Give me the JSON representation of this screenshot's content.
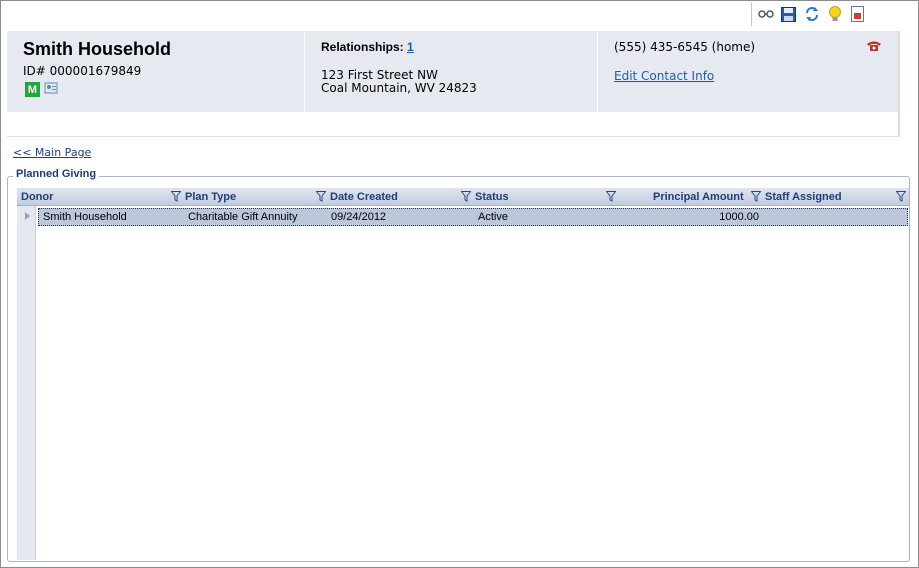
{
  "toolbar": {
    "icons": [
      "glasses-icon",
      "save-icon",
      "refresh-icon",
      "lightbulb-icon",
      "report-icon"
    ]
  },
  "header": {
    "name": "Smith Household",
    "id_line": "ID# 000001679849",
    "member_badge": "M",
    "relationships_label": "Relationships:",
    "relationships_count": "1",
    "address_line1": "123 First Street NW",
    "address_line2": "Coal Mountain, WV 24823",
    "phone": "(555) 435-6545 (home)",
    "edit_contact": "Edit Contact Info"
  },
  "nav": {
    "main_page_link": "<< Main Page"
  },
  "planned_giving": {
    "legend": "Planned Giving",
    "columns": [
      "Donor",
      "Plan Type",
      "Date Created",
      "Status",
      "Principal Amount",
      "Staff Assigned"
    ],
    "rows": [
      {
        "donor": "Smith Household",
        "plan_type": "Charitable Gift Annuity",
        "date_created": "09/24/2012",
        "status": "Active",
        "principal_amount": "1000.00",
        "staff_assigned": ""
      }
    ]
  },
  "colors": {
    "header_bg": "#e6e9ef",
    "link": "#1a5fb4",
    "grid_header_text": "#1d3f78",
    "selected_row": "#bcc8da",
    "member_badge": "#1fa83a"
  }
}
